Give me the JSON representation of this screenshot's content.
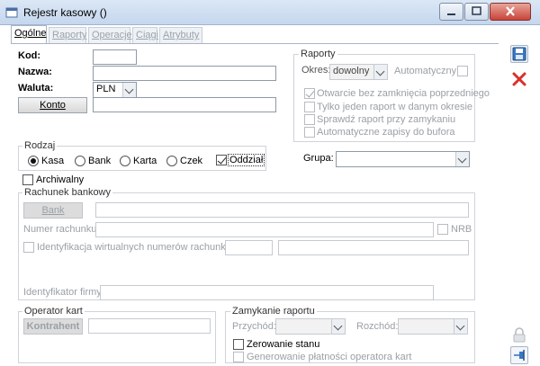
{
  "window": {
    "title": "Rejestr kasowy ()"
  },
  "tabs": [
    "Ogólne",
    "Raporty",
    "Operacje",
    "Ciągi",
    "Atrybuty"
  ],
  "general": {
    "kod_label": "Kod:",
    "nazwa_label": "Nazwa:",
    "waluta_label": "Waluta:",
    "waluta_value": "PLN",
    "konto_button": "Konto"
  },
  "raporty": {
    "title": "Raporty",
    "okres_label": "Okres:",
    "okres_value": "dowolny",
    "automatyczny_label": "Automatyczny",
    "options": [
      {
        "label": "Otwarcie bez zamknięcia poprzedniego",
        "checked": true
      },
      {
        "label": "Tylko jeden raport w danym okresie",
        "checked": false
      },
      {
        "label": "Sprawdź raport przy zamykaniu",
        "checked": false
      },
      {
        "label": "Automatyczne zapisy do bufora",
        "checked": false
      }
    ]
  },
  "rodzaj": {
    "title": "Rodzaj",
    "options": [
      "Kasa",
      "Bank",
      "Karta",
      "Czek"
    ],
    "selected": "Kasa",
    "oddzial_label": "Oddział",
    "oddzial_checked": true
  },
  "grupa": {
    "label": "Grupa:",
    "value": ""
  },
  "archiwalny_label": "Archiwalny",
  "rachunek": {
    "title": "Rachunek bankowy",
    "bank_button": "Bank",
    "numer_label": "Numer rachunku:",
    "nrb_label": "NRB",
    "ident_label": "Identyfikacja wirtualnych numerów rachunków",
    "ident_firmy_label": "Identyfikator firmy:"
  },
  "operator": {
    "title": "Operator kart",
    "kontrahent_button": "Kontrahent"
  },
  "zamykanie": {
    "title": "Zamykanie raportu",
    "przychod_label": "Przychód:",
    "rozchod_label": "Rozchód:",
    "zerowanie_label": "Zerowanie stanu",
    "generowanie_label": "Generowanie płatności operatora kart"
  },
  "colors": {
    "titlebar": "#c5d7ee",
    "close": "#c8443a",
    "accent": "#3b78c4"
  },
  "icons": [
    "app-icon",
    "save-icon",
    "delete-icon",
    "lock-icon",
    "pin-icon"
  ]
}
